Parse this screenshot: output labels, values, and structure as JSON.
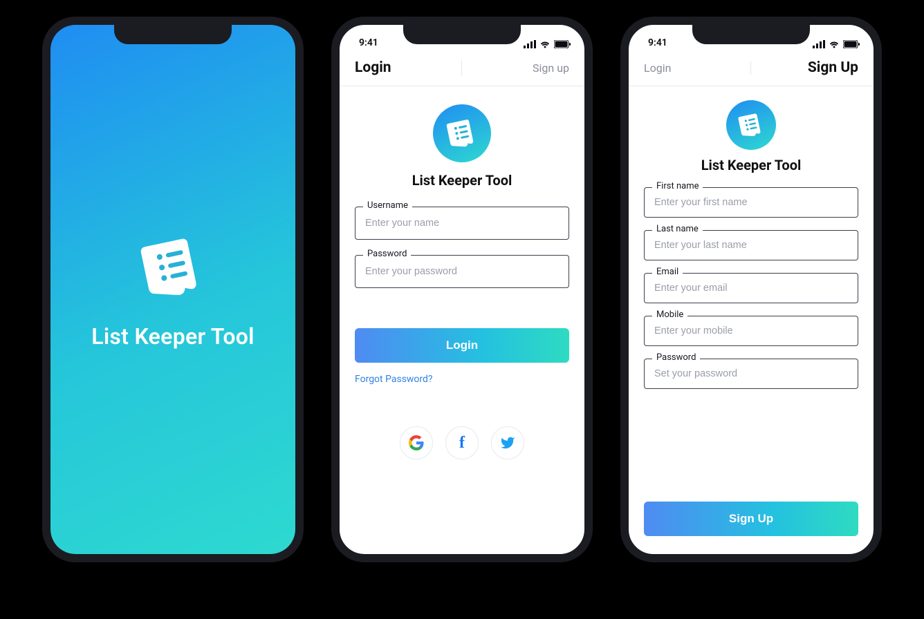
{
  "status": {
    "time": "9:41"
  },
  "app": {
    "title": "List Keeper Tool"
  },
  "login": {
    "tab_active": "Login",
    "tab_inactive": "Sign up",
    "fields": {
      "username": {
        "label": "Username",
        "placeholder": "Enter your name"
      },
      "password": {
        "label": "Password",
        "placeholder": "Enter your password"
      }
    },
    "cta": "Login",
    "forgot": "Forgot Password?",
    "social": {
      "google": "G",
      "facebook": "f",
      "twitter": "t"
    }
  },
  "signup": {
    "tab_inactive": "Login",
    "tab_active": "Sign Up",
    "fields": {
      "first_name": {
        "label": "First name",
        "placeholder": "Enter your first name"
      },
      "last_name": {
        "label": "Last name",
        "placeholder": "Enter your last name"
      },
      "email": {
        "label": "Email",
        "placeholder": "Enter your email"
      },
      "mobile": {
        "label": "Mobile",
        "placeholder": "Enter your mobile"
      },
      "password": {
        "label": "Password",
        "placeholder": "Set your password"
      }
    },
    "cta": "Sign Up"
  }
}
